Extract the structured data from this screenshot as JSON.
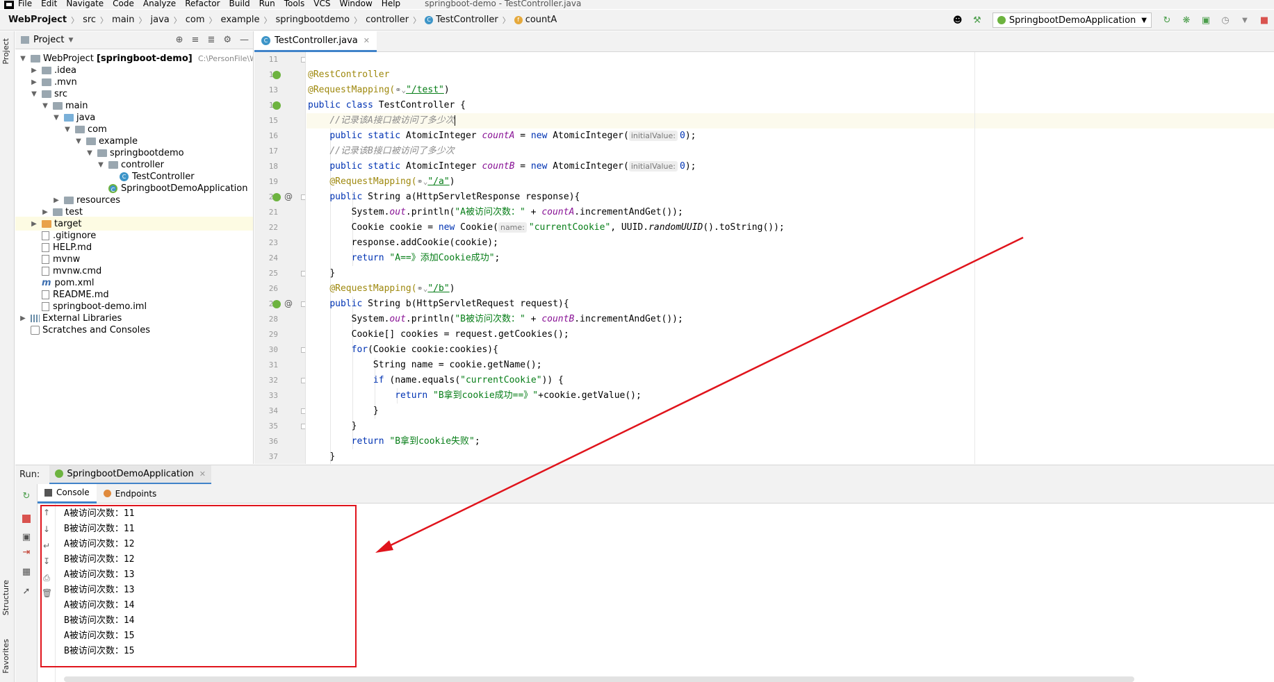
{
  "menubar": {
    "items": [
      "File",
      "Edit",
      "Navigate",
      "Code",
      "Analyze",
      "Refactor",
      "Build",
      "Run",
      "Tools",
      "VCS",
      "Window",
      "Help"
    ],
    "window_title": "springboot-demo - TestController.java"
  },
  "breadcrumb": {
    "project": "WebProject",
    "items": [
      "src",
      "main",
      "java",
      "com",
      "example",
      "springbootdemo",
      "controller"
    ],
    "class": "TestController",
    "field": "countA"
  },
  "toolbar": {
    "run_config": "SpringbootDemoApplication"
  },
  "side_labels": {
    "project": "Project",
    "structure": "Structure",
    "favorites": "Favorites"
  },
  "project_panel": {
    "title": "Project",
    "tree": [
      {
        "label": "WebProject",
        "bold_suffix": "[springboot-demo]",
        "path": "C:\\PersonFile\\Web"
      },
      {
        "label": ".idea"
      },
      {
        "label": ".mvn"
      },
      {
        "label": "src"
      },
      {
        "label": "main"
      },
      {
        "label": "java"
      },
      {
        "label": "com"
      },
      {
        "label": "example"
      },
      {
        "label": "springbootdemo"
      },
      {
        "label": "controller"
      },
      {
        "label": "TestController"
      },
      {
        "label": "SpringbootDemoApplication"
      },
      {
        "label": "resources"
      },
      {
        "label": "test"
      },
      {
        "label": "target"
      },
      {
        "label": ".gitignore"
      },
      {
        "label": "HELP.md"
      },
      {
        "label": "mvnw"
      },
      {
        "label": "mvnw.cmd"
      },
      {
        "label": "pom.xml"
      },
      {
        "label": "README.md"
      },
      {
        "label": "springboot-demo.iml"
      },
      {
        "label": "External Libraries"
      },
      {
        "label": "Scratches and Consoles"
      }
    ]
  },
  "editor": {
    "tab_label": "TestController.java",
    "line_numbers": [
      "11",
      "12",
      "13",
      "14",
      "15",
      "16",
      "17",
      "18",
      "19",
      "20",
      "21",
      "22",
      "23",
      "24",
      "25",
      "26",
      "27",
      "28",
      "29",
      "30",
      "31",
      "32",
      "33",
      "34",
      "35",
      "36",
      "37"
    ],
    "code": {
      "l12": "@RestController",
      "l13a": "@RequestMapping(",
      "l13b": "\"/test\"",
      "l13c": ")",
      "l14a": "public class ",
      "l14b": "TestController {",
      "l15": "//记录该A接口被访问了多少次",
      "l16a": "public static ",
      "l16b": "AtomicInteger ",
      "l16c": "countA",
      "l16d": " = ",
      "l16e": "new ",
      "l16f": "AtomicInteger(",
      "hint_initial": "initialValue:",
      "l16g": "0",
      "l16h": ");",
      "l17": "//记录该B接口被访问了多少次",
      "l18c": "countB",
      "l19a": "@RequestMapping(",
      "l19b": "\"/a\"",
      "l20a": "public ",
      "l20b": "String a(HttpServletResponse response){",
      "l21a": "System.",
      "l21b": "out",
      "l21c": ".println(",
      "l21d": "\"A被访问次数：\"",
      "l21e": " + ",
      "l21f": "countA",
      "l21g": ".incrementAndGet());",
      "l22a": "Cookie cookie = ",
      "l22b": "new ",
      "l22c": "Cookie(",
      "hint_name": "name:",
      "l22d": "\"currentCookie\"",
      "l22e": ", UUID.",
      "l22f": "randomUUID",
      "l22g": "().toString());",
      "l23": "response.addCookie(cookie);",
      "l24a": "return ",
      "l24b": "\"A==》添加Cookie成功\"",
      "l24c": ";",
      "l25": "}",
      "l26b": "\"/b\"",
      "l27b": "String b(HttpServletRequest request){",
      "l28d": "\"B被访问次数：\"",
      "l28f": "countB",
      "l29": "Cookie[] cookies = request.getCookies();",
      "l30a": "for",
      "l30b": "(Cookie cookie:cookies){",
      "l31": "String name = cookie.getName();",
      "l32a": "if ",
      "l32b": "(name.equals(",
      "l32c": "\"currentCookie\"",
      "l32d": ")) {",
      "l33b": "\"B拿到cookie成功==》\"",
      "l33c": "+cookie.getValue();",
      "l34": "}",
      "l35": "}",
      "l36b": "\"B拿到cookie失败\"",
      "l37": "}"
    }
  },
  "run_panel": {
    "label": "Run:",
    "tab": "SpringbootDemoApplication",
    "subtabs": [
      "Console",
      "Endpoints"
    ],
    "output": [
      "A被访问次数：11",
      "B被访问次数：11",
      "A被访问次数：12",
      "B被访问次数：12",
      "A被访问次数：13",
      "B被访问次数：13",
      "A被访问次数：14",
      "B被访问次数：14",
      "A被访问次数：15",
      "B被访问次数：15"
    ]
  },
  "colors": {
    "annotation_red": "#e0141c",
    "accent_blue": "#4083c9",
    "spring_green": "#6db33f"
  }
}
